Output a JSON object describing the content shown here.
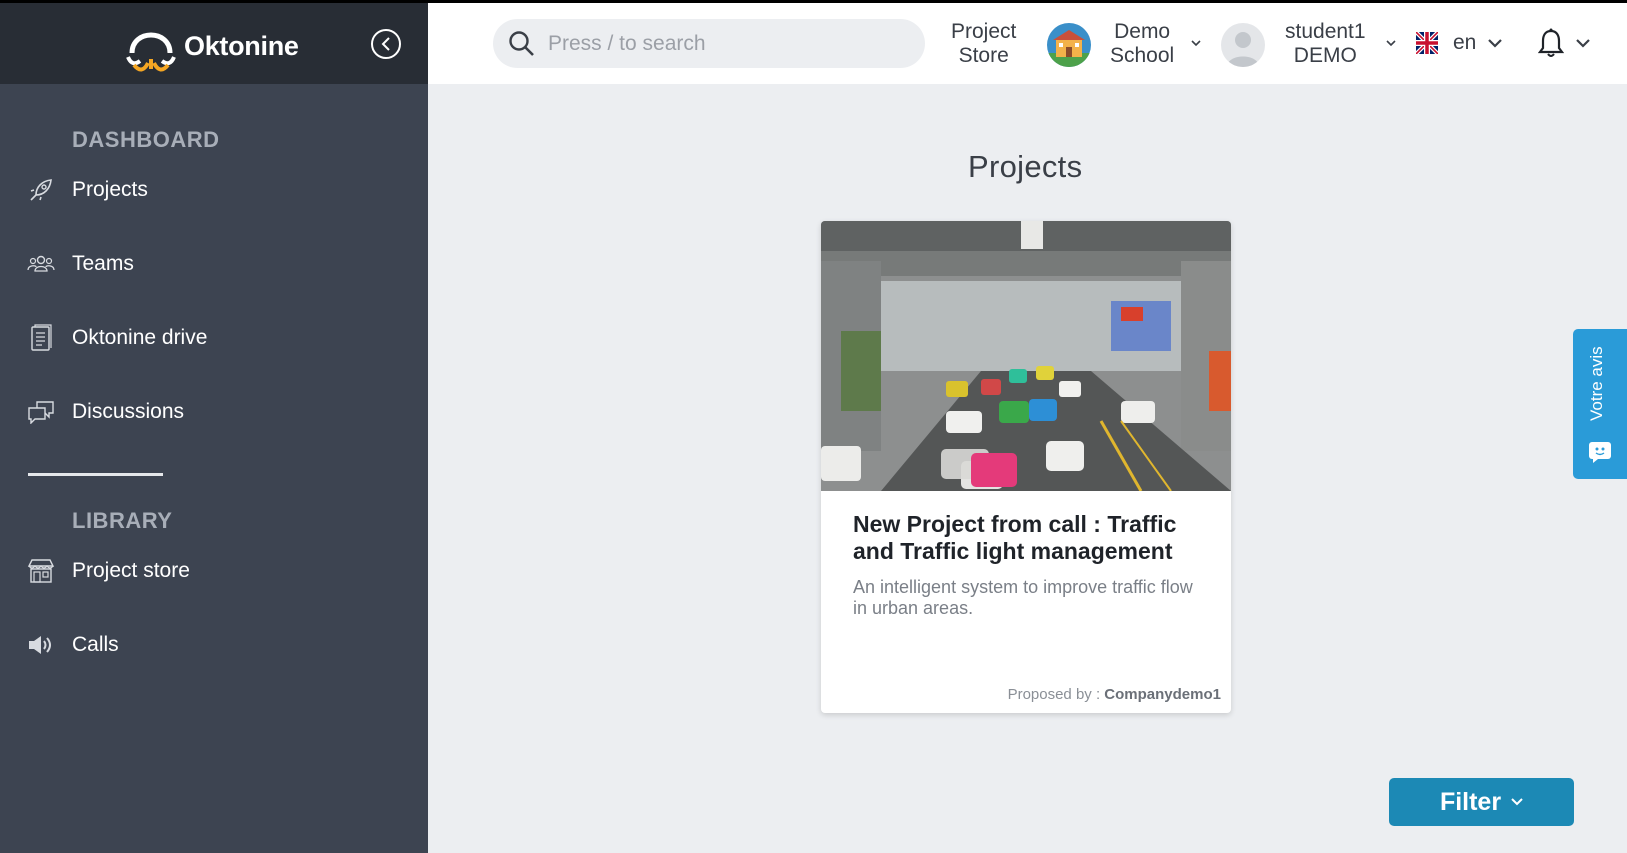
{
  "brand": {
    "name": "Oktonine",
    "accent": "#f5a623"
  },
  "sidebar": {
    "sections": [
      {
        "title": "DASHBOARD"
      },
      {
        "title": "LIBRARY"
      }
    ],
    "items": [
      {
        "label": "Projects",
        "icon": "rocket-icon"
      },
      {
        "label": "Teams",
        "icon": "team-icon"
      },
      {
        "label": "Oktonine drive",
        "icon": "document-icon"
      },
      {
        "label": "Discussions",
        "icon": "chat-icon"
      },
      {
        "label": "Project store",
        "icon": "store-icon"
      },
      {
        "label": "Calls",
        "icon": "megaphone-icon"
      }
    ]
  },
  "header": {
    "search_placeholder": "Press / to search",
    "project_store": {
      "line1": "Project",
      "line2": "Store"
    },
    "school": {
      "line1": "Demo",
      "line2": "School"
    },
    "user": {
      "line1": "student1",
      "line2": "DEMO"
    },
    "language": "en"
  },
  "main": {
    "title": "Projects",
    "card": {
      "title": "New Project from call : Traffic and Traffic light management",
      "description": "An intelligent system to improve traffic flow in urban areas.",
      "proposed_label": "Proposed by :",
      "proposed_by": "Companydemo1"
    },
    "filter_label": "Filter"
  },
  "feedback": {
    "label": "Votre avis"
  },
  "colors": {
    "sidebar": "#3d4451",
    "sidebar_header": "#282d35",
    "filter": "#1c89b5",
    "feedback": "#2a9bd8"
  }
}
